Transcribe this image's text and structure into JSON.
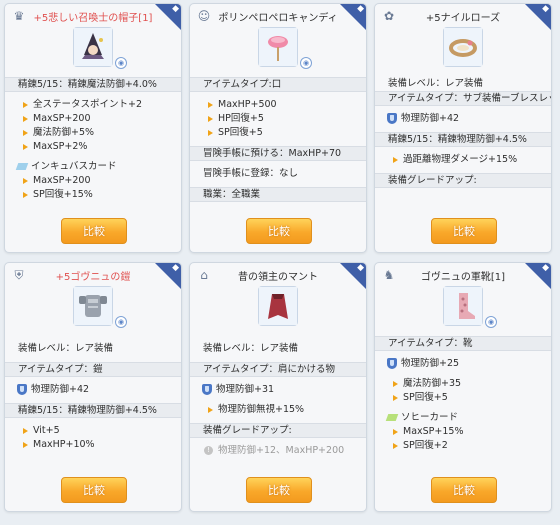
{
  "compare_label": "比較",
  "cards": [
    {
      "title": "+5悲しい召喚士の帽子[1]",
      "type_icon": "headgear-icon",
      "lines": [
        "精錬5/15：精錬魔法防御+4.0%",
        "全ステータスポイント+2",
        "MaxSP+200",
        "魔法防御+5%",
        "MaxSP+2%",
        "インキュバスカード",
        "MaxSP+200",
        "SP回復+15%"
      ]
    },
    {
      "title": "ポリンペロペロキャンディ",
      "type_icon": "mouth-icon",
      "lines": [
        "アイテムタイプ:口",
        "MaxHP+500",
        "HP回復+5",
        "SP回復+5",
        "冒険手帳に預ける：MaxHP+70",
        "冒険手帳に登録：なし",
        "職業：全職業"
      ]
    },
    {
      "title": "+5ナイルローズ",
      "type_icon": "accessory-icon",
      "lines": [
        "装備レベル：レア装備",
        "アイテムタイプ：サブ装備ーブレスレット",
        "物理防御+42",
        "精錬5/15：精錬物理防御+4.5%",
        "過距離物理ダメージ+15%",
        "装備グレードアップ:"
      ]
    },
    {
      "title": "+5ゴヴニュの鎧",
      "type_icon": "armor-icon",
      "lines": [
        "装備レベル：レア装備",
        "アイテムタイプ：鎧",
        "物理防御+42",
        "精錬5/15：精錬物理防御+4.5%",
        "Vit+5",
        "MaxHP+10%"
      ]
    },
    {
      "title": "昔の領主のマント",
      "type_icon": "cape-icon",
      "lines": [
        "装備レベル：レア装備",
        "アイテムタイプ：肩にかける物",
        "物理防御+31",
        "物理防御無視+15%",
        "装備グレードアップ:",
        "物理防御+12、MaxHP+200"
      ]
    },
    {
      "title": "ゴヴニュの軍靴[1]",
      "type_icon": "shoes-icon",
      "lines": [
        "アイテムタイプ：靴",
        "物理防御+25",
        "魔法防御+35",
        "SP回復+5",
        "ソヒーカード",
        "MaxSP+15%",
        "SP回復+2"
      ]
    }
  ]
}
